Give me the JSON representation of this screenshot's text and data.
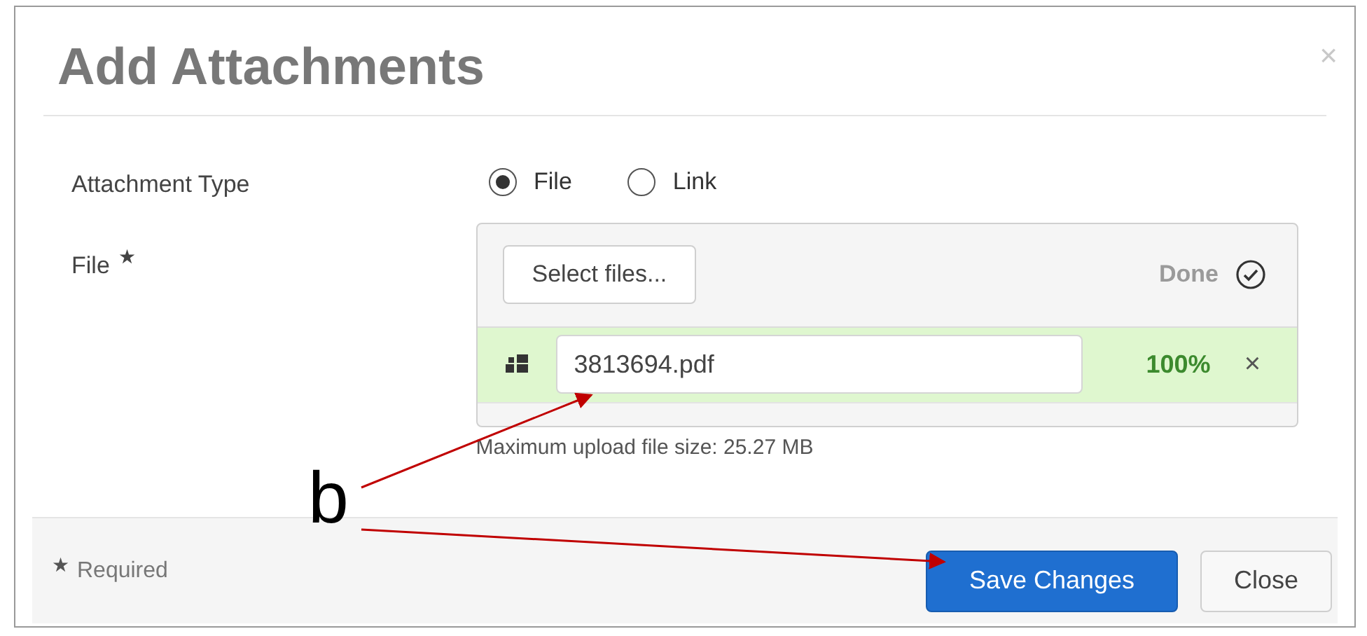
{
  "dialog": {
    "title": "Add Attachments",
    "close": "×"
  },
  "attachment_type": {
    "label": "Attachment Type",
    "options": [
      {
        "label": "File",
        "selected": true
      },
      {
        "label": "Link",
        "selected": false
      }
    ]
  },
  "file": {
    "label": "File",
    "required_mark": "★",
    "select_button": "Select files...",
    "status": "Done",
    "uploads": [
      {
        "name": "3813694.pdf",
        "percent": "100%",
        "remove": "×"
      }
    ],
    "hint": "Maximum upload file size: 25.27 MB"
  },
  "footer": {
    "required_mark": "★",
    "required_note": "Required",
    "buttons": [
      {
        "label": "Save Changes",
        "kind": "primary"
      },
      {
        "label": "Close",
        "kind": "default"
      }
    ]
  },
  "annotation": {
    "letter": "b"
  }
}
